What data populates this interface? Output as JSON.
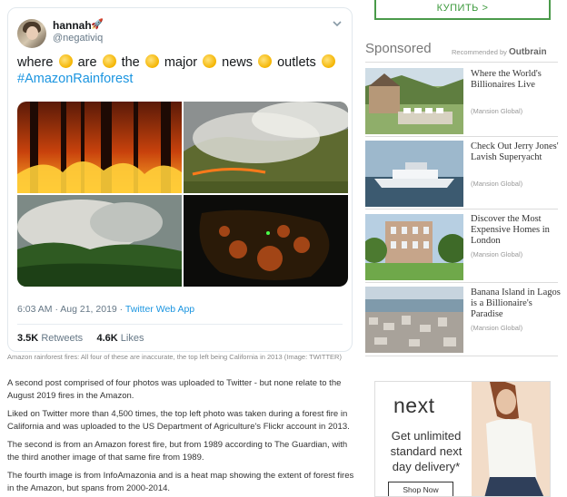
{
  "tweet": {
    "user_name": "hannah",
    "user_handle": "@negativiq",
    "text_words": [
      "where",
      "are",
      "the",
      "major",
      "news",
      "outlets"
    ],
    "hashtag": "#AmazonRainforest",
    "time": "6:03 AM · Aug 21, 2019 · ",
    "app": "Twitter Web App",
    "retweets_count": "3.5K",
    "retweets_label": "Retweets",
    "likes_count": "4.6K",
    "likes_label": "Likes"
  },
  "article": {
    "caption": "Amazon rainforest fires: All four of these are inaccurate, the top left being California in 2013",
    "caption_credit": "(Image: TWITTER)",
    "paragraphs": [
      "A second post comprised of four photos was uploaded to Twitter - but none relate to the August 2019 fires in the Amazon.",
      "Liked on Twitter more than 4,500 times, the top left photo was taken during a forest fire in California and was uploaded to the US Department of Agriculture's Flickr account in 2013.",
      "The second is from an Amazon forest fire, but from 1989 according to The Guardian, with the third another image of that same fire from 1989.",
      "The fourth image is from InfoAmazonia and is a heat map showing the extent of forest fires in the Amazon, but spans from 2000-2014."
    ]
  },
  "sidebar": {
    "buy_label": "КУПИТЬ >",
    "sponsored_label": "Sponsored",
    "recommended_by": "Recommended by",
    "outbrain": "Outbrain",
    "ads": [
      {
        "title": "Where the World's Billionaires Live",
        "source": "(Mansion Global)"
      },
      {
        "title": "Check Out Jerry Jones' Lavish Superyacht",
        "source": "(Mansion Global)"
      },
      {
        "title": "Discover the Most Expensive Homes in London",
        "source": "(Mansion Global)"
      },
      {
        "title": "Banana Island in Lagos is a Billionaire's Paradise",
        "source": "(Mansion Global)"
      }
    ],
    "banner": {
      "logo": "next",
      "copy": "Get unlimited standard next day delivery*",
      "button": "Shop Now"
    }
  },
  "colors": {
    "link_blue": "#1b95e0",
    "buy_green": "#3c9a3c"
  }
}
